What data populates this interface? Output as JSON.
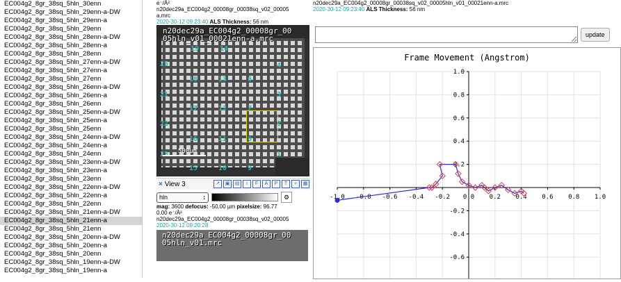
{
  "file_list": {
    "items": [
      "EC004g2_8gr_38sq_5hln_30enn",
      "EC004g2_8gr_38sq_5hln_29enn-a-DW",
      "EC004g2_8gr_38sq_5hln_29enn-a",
      "EC004g2_8gr_38sq_5hln_29enn",
      "EC004g2_8gr_38sq_5hln_28enn-a-DW",
      "EC004g2_8gr_38sq_5hln_28enn-a",
      "EC004g2_8gr_38sq_5hln_28enn",
      "EC004g2_8gr_38sq_5hln_27enn-a-DW",
      "EC004g2_8gr_38sq_5hln_27enn-a",
      "EC004g2_8gr_38sq_5hln_27enn",
      "EC004g2_8gr_38sq_5hln_26enn-a-DW",
      "EC004g2_8gr_38sq_5hln_26enn-a",
      "EC004g2_8gr_38sq_5hln_26enn",
      "EC004g2_8gr_38sq_5hln_25enn-a-DW",
      "EC004g2_8gr_38sq_5hln_25enn-a",
      "EC004g2_8gr_38sq_5hln_25enn",
      "EC004g2_8gr_38sq_5hln_24enn-a-DW",
      "EC004g2_8gr_38sq_5hln_24enn-a",
      "EC004g2_8gr_38sq_5hln_24enn",
      "EC004g2_8gr_38sq_5hln_23enn-a-DW",
      "EC004g2_8gr_38sq_5hln_23enn-a",
      "EC004g2_8gr_38sq_5hln_23enn",
      "EC004g2_8gr_38sq_5hln_22enn-a-DW",
      "EC004g2_8gr_38sq_5hln_22enn-a",
      "EC004g2_8gr_38sq_5hln_22enn",
      "EC004g2_8gr_38sq_5hln_21enn-a-DW",
      "EC004g2_8gr_38sq_5hln_21enn-a",
      "EC004g2_8gr_38sq_5hln_21enn",
      "EC004g2_8gr_38sq_5hln_20enn-a-DW",
      "EC004g2_8gr_38sq_5hln_20enn-a",
      "EC004g2_8gr_38sq_5hln_20enn",
      "EC004g2_8gr_38sq_5hln_19enn-a-DW",
      "EC004g2_8gr_38sq_5hln_19enn-a"
    ],
    "selected_index": 26
  },
  "view2": {
    "dose": "e⁻/Å²",
    "filename": "n20dec29a_EC004g2_00008gr_00038sq_v02_00005",
    "filename_cont": "a.mrc",
    "timestamp": "2020-30-12 09:23:40",
    "als_label": "ALS Thickness:",
    "als_value": "56 nm",
    "image_title_line1": "n20dec29a_EC004g2_00008gr_00",
    "image_title_line2": "05hln_v01_00021enn-a.mrc",
    "scalebar_label": "500um",
    "square_labels": [
      {
        "text": "25"
      },
      {
        "text": "19"
      },
      {
        "text": "14"
      },
      {
        "text": "4"
      },
      {
        "text": "18"
      },
      {
        "text": "13"
      },
      {
        "text": "6"
      },
      {
        "text": "21"
      },
      {
        "text": "3"
      },
      {
        "text": "17"
      },
      {
        "text": "12"
      },
      {
        "text": "7"
      },
      {
        "text": "22"
      },
      {
        "text": "2"
      },
      {
        "text": "16"
      },
      {
        "text": "11"
      },
      {
        "text": "8"
      },
      {
        "text": "23"
      },
      {
        "text": "1"
      },
      {
        "text": "15"
      },
      {
        "text": "10"
      },
      {
        "text": "9"
      }
    ]
  },
  "view3": {
    "close_icon": "×",
    "title": "View 3",
    "filter_value": "hln",
    "mag_label": "mag:",
    "mag_value": "3600",
    "defocus_label": "defocus:",
    "defocus_value": "-50.00 µm",
    "pixelsize_label": "pixelsize:",
    "pixelsize_value": "96.77",
    "dose": "0.00 e⁻/Å²",
    "filename": "n20dec29a_EC004g2_00008gr_00038sq_v02_00005",
    "timestamp": "2020-30-12 09:20:28",
    "image_title_line1": "n20dec29a_EC004g2_00008gr_00",
    "image_title_line2": "05hln_v01.mrc"
  },
  "right_panel": {
    "filename": "n20dec29a_EC004g2_00008gr_00038sq_v02_00005hln_v01_00021enn-a.mrc",
    "timestamp": "2020-30-12 09:23:40",
    "als_label": "ALS Thickness:",
    "als_value": "56 nm",
    "command_value": "",
    "update_label": "update"
  },
  "chart_data": {
    "type": "line",
    "title": "Frame Movement (Angstrom)",
    "xlim": [
      -1.0,
      1.0
    ],
    "ylim": [
      -0.6,
      1.0
    ],
    "xticks": [
      "-1.0",
      "-0.8",
      "-0.6",
      "-0.4",
      "-0.2",
      "0.0",
      "0.2",
      "0.4",
      "0.6",
      "0.8",
      "1.0"
    ],
    "yticks": [
      "1.0",
      "0.8",
      "0.6",
      "0.4",
      "0.2",
      "0.0",
      "-0.2",
      "-0.4",
      "-0.6"
    ],
    "grid": true,
    "series": [
      {
        "points": [
          [
            -1.0,
            -0.11
          ],
          [
            -0.3,
            0.0
          ],
          [
            -0.28,
            0.0
          ],
          [
            -0.25,
            0.03
          ],
          [
            -0.2,
            0.1
          ],
          [
            -0.22,
            0.2
          ],
          [
            -0.1,
            0.2
          ],
          [
            -0.08,
            0.12
          ],
          [
            -0.05,
            0.05
          ],
          [
            0.0,
            0.02
          ],
          [
            0.05,
            0.0
          ],
          [
            0.1,
            0.02
          ],
          [
            0.12,
            0.0
          ],
          [
            0.15,
            -0.03
          ],
          [
            0.2,
            0.0
          ],
          [
            0.25,
            0.02
          ],
          [
            0.3,
            -0.02
          ],
          [
            0.35,
            -0.05
          ],
          [
            0.4,
            -0.03
          ],
          [
            0.42,
            -0.05
          ]
        ],
        "color": "#2a2adc"
      }
    ],
    "marker_color": "#e0404a",
    "start_marker_color": "#2a2adc"
  }
}
